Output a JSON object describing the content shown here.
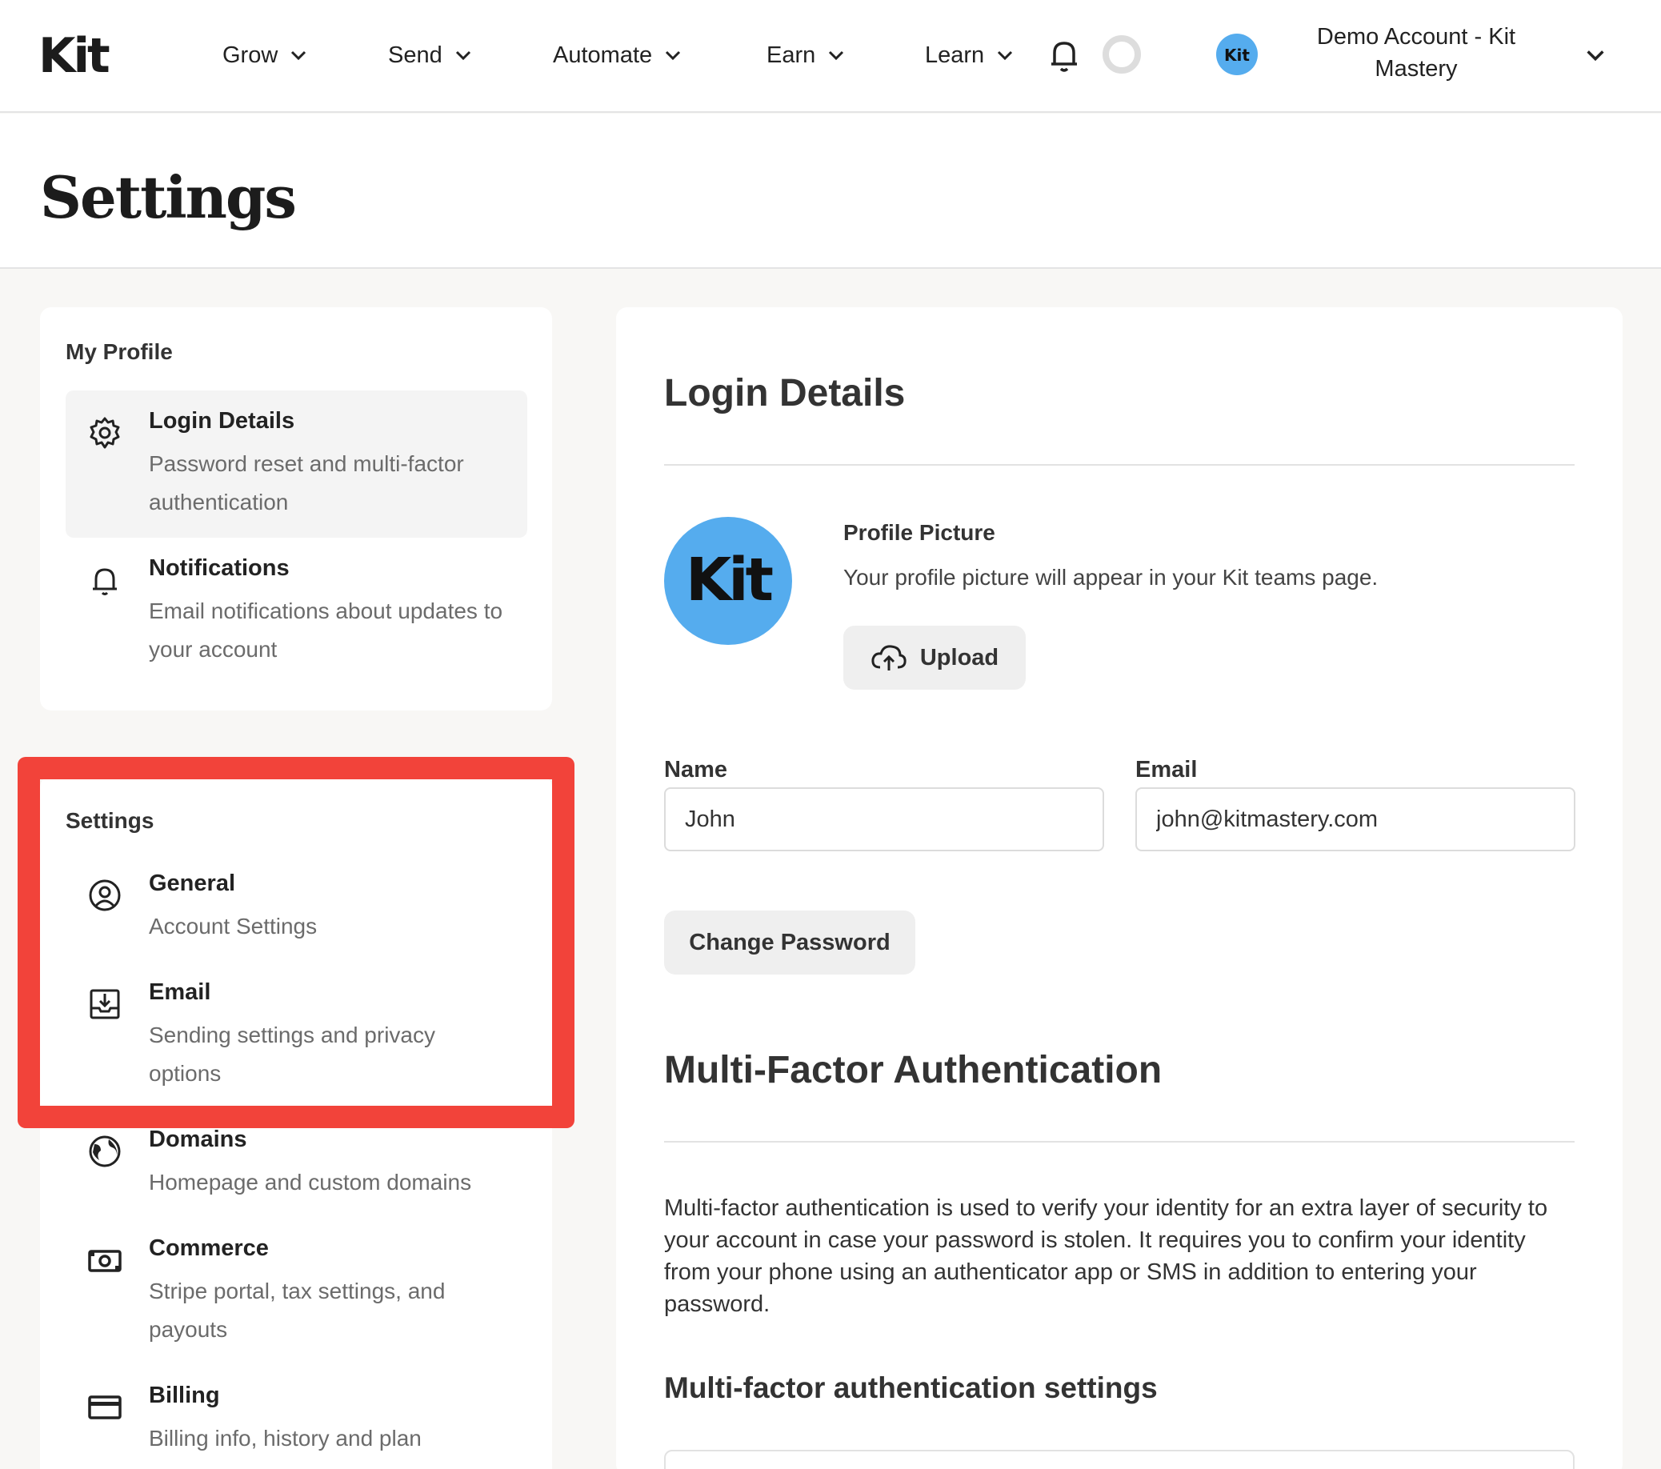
{
  "brand": {
    "logo_text": "Kit",
    "accent": "#55acee",
    "highlight": "#f2433a"
  },
  "nav": {
    "items": [
      {
        "label": "Grow"
      },
      {
        "label": "Send"
      },
      {
        "label": "Automate"
      },
      {
        "label": "Earn"
      },
      {
        "label": "Learn"
      }
    ],
    "account_name": "Demo Account - Kit Mastery"
  },
  "page": {
    "title": "Settings"
  },
  "profile_section": {
    "heading": "My Profile",
    "items": [
      {
        "title": "Login Details",
        "desc": "Password reset and multi-factor authentication",
        "icon": "gear-icon",
        "active": true
      },
      {
        "title": "Notifications",
        "desc": "Email notifications about updates to your account",
        "icon": "bell-icon"
      }
    ]
  },
  "settings_section": {
    "heading": "Settings",
    "items": [
      {
        "title": "General",
        "desc": "Account Settings",
        "icon": "user-circle-icon"
      },
      {
        "title": "Email",
        "desc": "Sending settings and privacy options",
        "icon": "inbox-download-icon"
      },
      {
        "title": "Domains",
        "desc": "Homepage and custom domains",
        "icon": "globe-icon"
      },
      {
        "title": "Commerce",
        "desc": "Stripe portal, tax settings, and payouts",
        "icon": "money-icon"
      },
      {
        "title": "Billing",
        "desc": "Billing info, history and plan",
        "icon": "credit-card-icon"
      }
    ]
  },
  "main": {
    "title": "Login Details",
    "profile_picture": {
      "label": "Profile Picture",
      "desc": "Your profile picture will appear in your Kit teams page.",
      "upload_label": "Upload"
    },
    "name_label": "Name",
    "name_value": "John",
    "email_label": "Email",
    "email_value": "john@kitmastery.com",
    "change_password_label": "Change Password",
    "mfa_title": "Multi-Factor Authentication",
    "mfa_desc": "Multi-factor authentication is used to verify your identity for an extra layer of security to your account in case your password is stolen. It requires you to confirm your identity from your phone using an authenticator app or SMS in addition to entering your password.",
    "mfa_settings_title": "Multi-factor authentication settings"
  }
}
